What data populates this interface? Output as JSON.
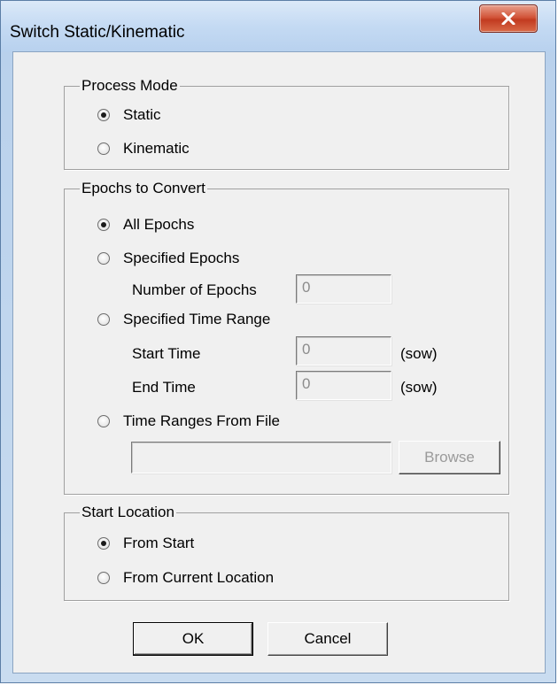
{
  "window": {
    "title": "Switch Static/Kinematic"
  },
  "process_mode": {
    "label": "Process Mode",
    "options": [
      {
        "label": "Static",
        "checked": true
      },
      {
        "label": "Kinematic",
        "checked": false
      }
    ]
  },
  "epochs": {
    "label": "Epochs to Convert",
    "all_epochs": "All Epochs",
    "specified_epochs": "Specified Epochs",
    "number_of_epochs_label": "Number of Epochs",
    "number_of_epochs_value": "0",
    "specified_time_range": "Specified Time Range",
    "start_time_label": "Start Time",
    "start_time_value": "0",
    "end_time_label": "End Time",
    "end_time_value": "0",
    "unit": "(sow)",
    "time_ranges_from_file": "Time Ranges From File",
    "file_path_value": "",
    "browse_label": "Browse",
    "selected": "All Epochs"
  },
  "start_location": {
    "label": "Start Location",
    "options": [
      {
        "label": "From Start",
        "checked": true
      },
      {
        "label": "From Current Location",
        "checked": false
      }
    ]
  },
  "buttons": {
    "ok": "OK",
    "cancel": "Cancel"
  },
  "colors": {
    "close_button": "#c9452b",
    "dialog_face": "#f0f0f0",
    "frame": "#b9d1ec"
  },
  "icons": {
    "close": "close-icon"
  }
}
